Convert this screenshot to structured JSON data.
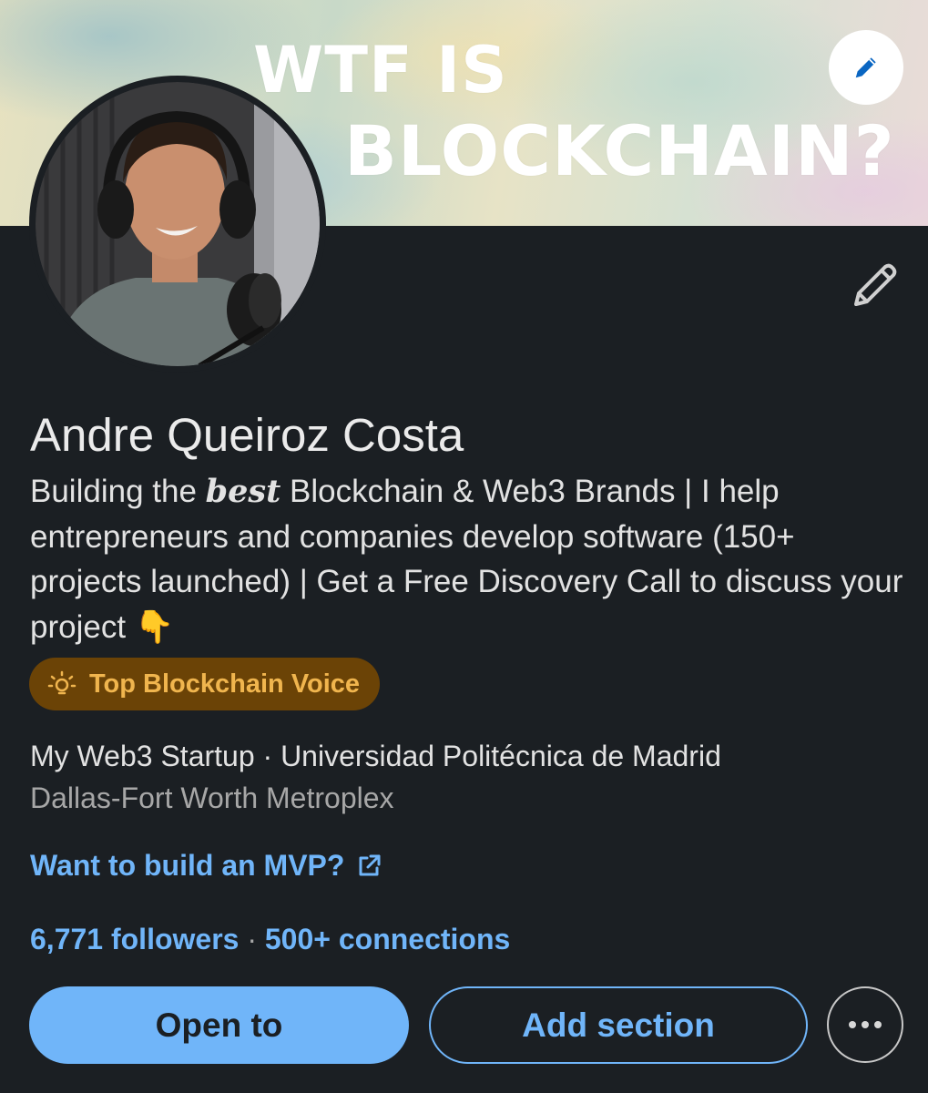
{
  "banner": {
    "line1": "WTF IS",
    "line2": "BLOCKCHAIN?"
  },
  "profile": {
    "name": "Andre Queiroz Costa",
    "headline_part1": "Building the ",
    "headline_emphasis": "best",
    "headline_part2": " Blockchain & Web3 Brands | I help entrepreneurs and companies develop software (150+ projects launched) | Get a Free Discovery Call to discuss your project ",
    "headline_emoji": "👇",
    "badge": "Top Blockchain Voice",
    "affiliation": "My Web3 Startup · Universidad Politécnica de Madrid",
    "location": "Dallas-Fort Worth Metroplex",
    "website_link": "Want to build an MVP?",
    "followers": "6,771 followers",
    "separator": " · ",
    "connections": "500+ connections"
  },
  "actions": {
    "open_to": "Open to",
    "add_section": "Add section",
    "more": "more-options"
  },
  "icons": {
    "banner_edit": "pencil-icon",
    "profile_edit": "pencil-icon",
    "badge": "lightbulb-icon",
    "link": "external-link-icon",
    "more": "ellipsis-icon"
  },
  "colors": {
    "background": "#1b1f23",
    "accent": "#70b5f9",
    "badge_bg": "#6b4306",
    "badge_text": "#f0b54e"
  }
}
